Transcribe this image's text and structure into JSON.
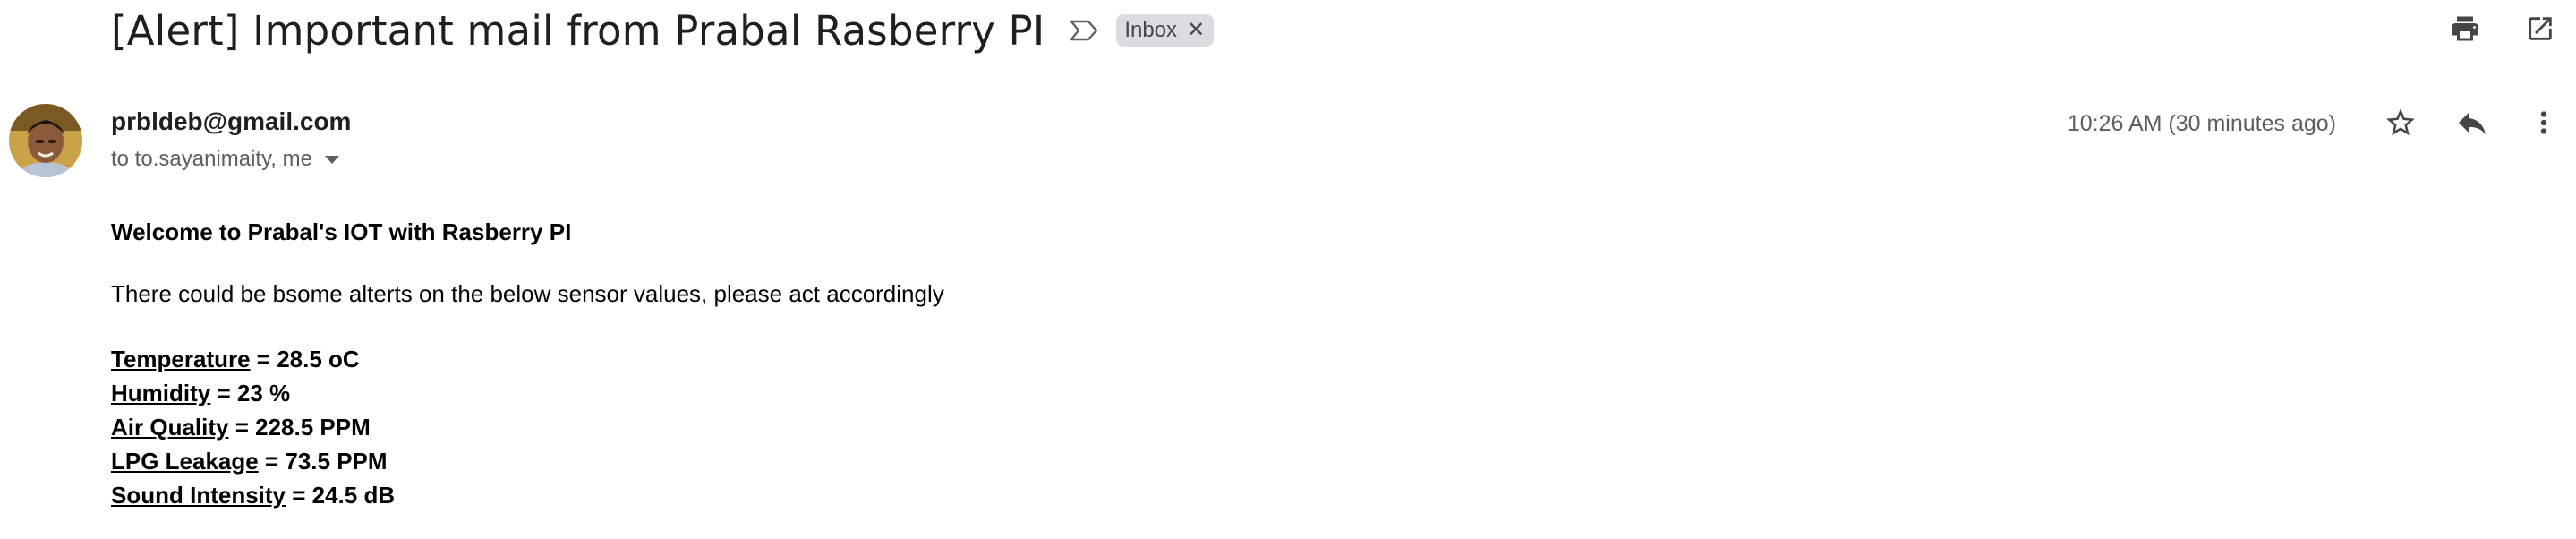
{
  "email": {
    "subject": "[Alert] Important mail from Prabal Rasberry PI",
    "label": "Inbox",
    "sender": "prbldeb@gmail.com",
    "recipients": "to to.sayanimaity, me",
    "time": "10:26 AM (30 minutes ago)"
  },
  "body": {
    "welcome": "Welcome to Prabal's IOT with Rasberry PI",
    "intro": "There could be bsome alterts on the below sensor values, please act accordingly",
    "readings": [
      {
        "name": "Temperature",
        "value": " = 28.5 oC"
      },
      {
        "name": "Humidity",
        "value": " = 23 %"
      },
      {
        "name": "Air Quality",
        "value": " = 228.5 PPM"
      },
      {
        "name": "LPG Leakage",
        "value": " = 73.5 PPM"
      },
      {
        "name": "Sound Intensity",
        "value": " = 24.5 dB"
      }
    ]
  },
  "icons": {
    "importance": "importance-marker-icon",
    "label_remove": "close-icon",
    "print": "print-icon",
    "open_new": "open-in-new-window-icon",
    "star": "star-icon",
    "reply": "reply-icon",
    "more": "more-vertical-icon",
    "recipients_caret": "caret-down-icon"
  },
  "colors": {
    "chip_bg": "#dadce0",
    "icon": "#444746",
    "secondary_text": "#5e5e5e"
  }
}
